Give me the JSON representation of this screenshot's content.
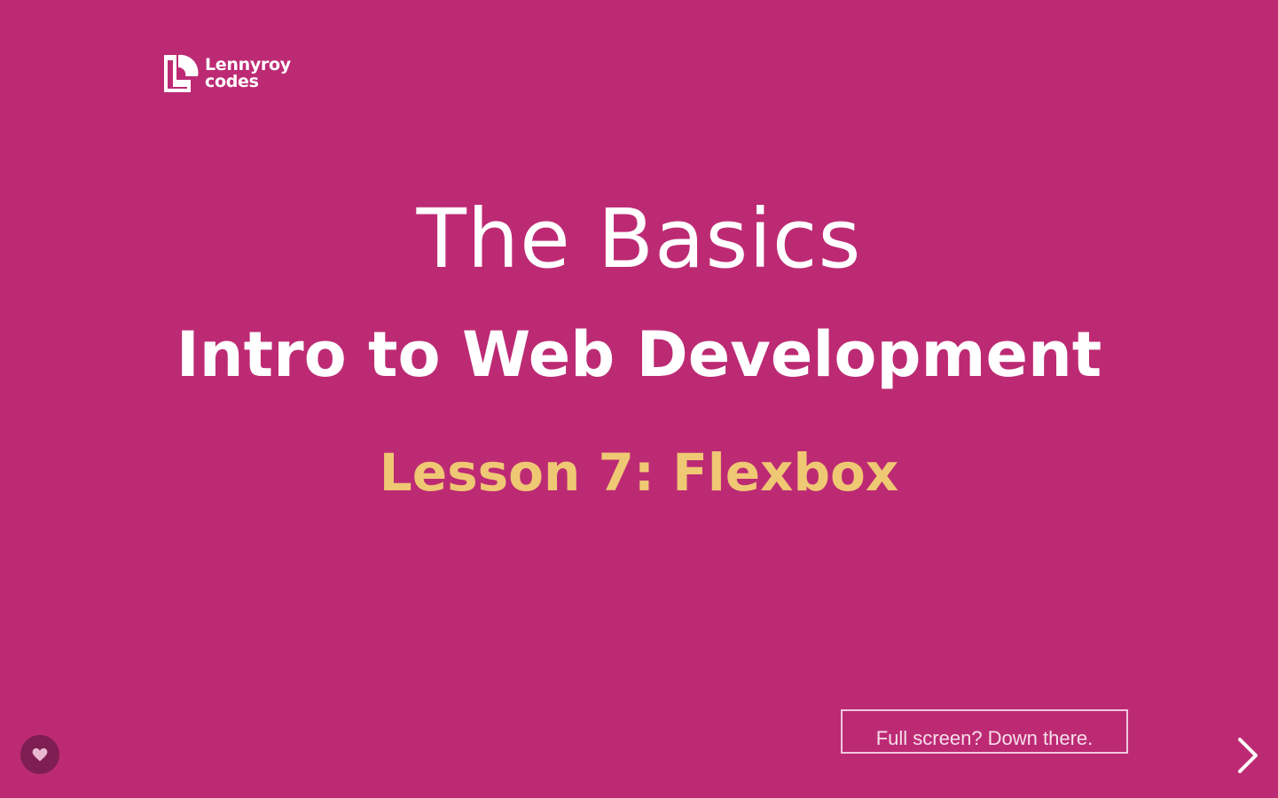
{
  "brand": {
    "logo_line1": "Lennyroy",
    "logo_line2": "codes",
    "logo_icon": "lennyroy-logo-icon"
  },
  "slide": {
    "title": "The Basics",
    "subtitle": "Intro to Web Development",
    "lesson": "Lesson 7: Flexbox"
  },
  "controls": {
    "fullscreen_hint": "Full screen? Down there.",
    "like_icon": "heart-icon",
    "next_icon": "chevron-right-icon"
  },
  "colors": {
    "background": "#bd2a74",
    "title_text": "#ffffff",
    "lesson_text": "#efc874",
    "like_button_bg": "#7e1e52"
  }
}
